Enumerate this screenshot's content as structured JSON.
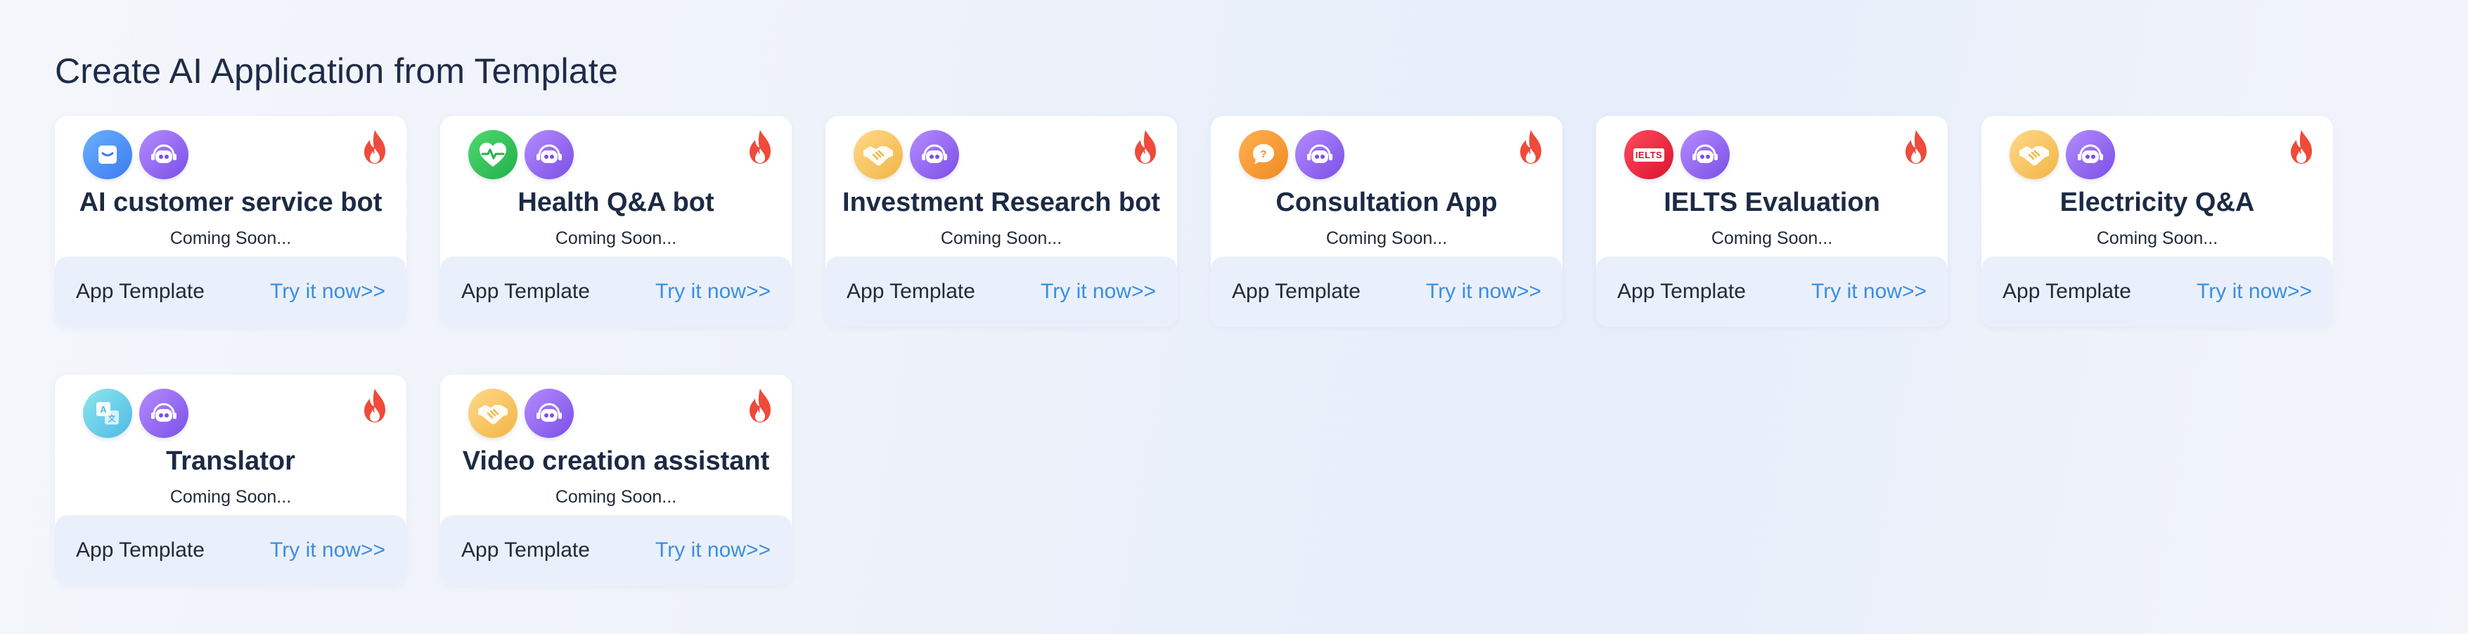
{
  "page": {
    "title": "Create AI Application from Template"
  },
  "colors": {
    "link": "#3a8ee0",
    "footer_bg": "#eaf0fb",
    "title_text": "#1c2a44",
    "fire": "#ef4a3a"
  },
  "cards": [
    {
      "title": "AI customer service bot",
      "subtitle": "Coming Soon...",
      "template_label": "App Template",
      "link_label": "Try it now>>",
      "icon": "message-icon",
      "icon_color": "blue"
    },
    {
      "title": "Health Q&A bot",
      "subtitle": "Coming Soon...",
      "template_label": "App Template",
      "link_label": "Try it now>>",
      "icon": "heart-pulse-icon",
      "icon_color": "green"
    },
    {
      "title": "Investment Research bot",
      "subtitle": "Coming Soon...",
      "template_label": "App Template",
      "link_label": "Try it now>>",
      "icon": "handshake-icon",
      "icon_color": "gold"
    },
    {
      "title": "Consultation App",
      "subtitle": "Coming Soon...",
      "template_label": "App Template",
      "link_label": "Try it now>>",
      "icon": "question-bubble-icon",
      "icon_color": "orange"
    },
    {
      "title": "IELTS Evaluation",
      "subtitle": "Coming Soon...",
      "template_label": "App Template",
      "link_label": "Try it now>>",
      "icon": "ielts-icon",
      "icon_color": "red",
      "icon_text": "IELTS"
    },
    {
      "title": "Electricity Q&A",
      "subtitle": "Coming Soon...",
      "template_label": "App Template",
      "link_label": "Try it now>>",
      "icon": "handshake-icon",
      "icon_color": "gold"
    },
    {
      "title": "Translator",
      "subtitle": "Coming Soon...",
      "template_label": "App Template",
      "link_label": "Try it now>>",
      "icon": "translate-icon",
      "icon_color": "teal"
    },
    {
      "title": "Video creation assistant",
      "subtitle": "Coming Soon...",
      "template_label": "App Template",
      "link_label": "Try it now>>",
      "icon": "handshake-icon",
      "icon_color": "gold"
    }
  ]
}
